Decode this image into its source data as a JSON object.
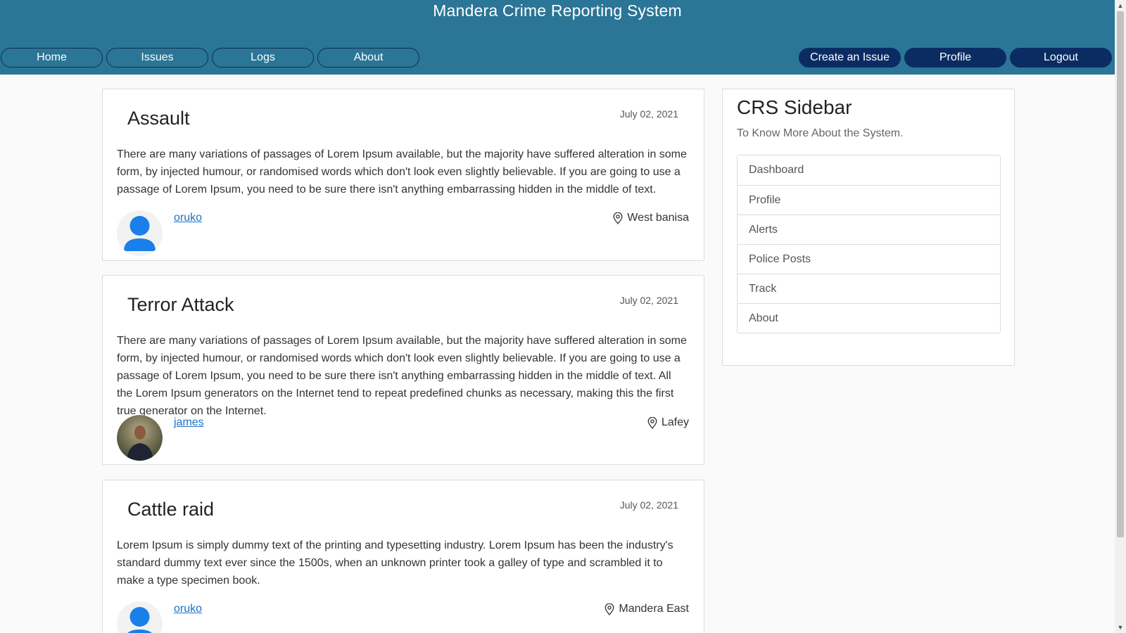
{
  "site": {
    "title": "Mandera Crime Reporting System"
  },
  "nav": {
    "left": [
      {
        "label": "Home"
      },
      {
        "label": "Issues"
      },
      {
        "label": "Logs"
      },
      {
        "label": "About"
      }
    ],
    "right": [
      {
        "label": "Create an Issue"
      },
      {
        "label": "Profile"
      },
      {
        "label": "Logout"
      }
    ]
  },
  "posts": [
    {
      "title": "Assault",
      "date": "July 02, 2021",
      "body": "There are many variations of passages of Lorem Ipsum available, but the majority have suffered alteration in some form, by injected humour, or randomised words which don't look even slightly believable. If you are going to use a passage of Lorem Ipsum, you need to be sure there isn't anything embarrassing hidden in the middle of text.",
      "author": "oruko",
      "location": "West banisa"
    },
    {
      "title": "Terror Attack",
      "date": "July 02, 2021",
      "body": "There are many variations of passages of Lorem Ipsum available, but the majority have suffered alteration in some form, by injected humour, or randomised words which don't look even slightly believable. If you are going to use a passage of Lorem Ipsum, you need to be sure there isn't anything embarrassing hidden in the middle of text. All the Lorem Ipsum generators on the Internet tend to repeat predefined chunks as necessary, making this the first true generator on the Internet.",
      "author": "james",
      "location": "Lafey"
    },
    {
      "title": "Cattle raid",
      "date": "July 02, 2021",
      "body": "Lorem Ipsum is simply dummy text of the printing and typesetting industry. Lorem Ipsum has been the industry's standard dummy text ever since the 1500s, when an unknown printer took a galley of type and scrambled it to make a type specimen book.",
      "author": "oruko",
      "location": "Mandera East"
    }
  ],
  "sidebar": {
    "title": "CRS Sidebar",
    "subtitle": "To Know More About the System.",
    "items": [
      {
        "label": "Dashboard"
      },
      {
        "label": "Profile"
      },
      {
        "label": "Alerts"
      },
      {
        "label": "Police Posts"
      },
      {
        "label": "Track"
      },
      {
        "label": "About"
      }
    ]
  },
  "colors": {
    "navbar": "#2b7596",
    "button_filled": "#0b2c63",
    "avatar_default": "#1a7fe8",
    "link": "#1a73c9"
  },
  "icons": {
    "location": "map-pin-icon",
    "default_avatar": "user-icon"
  }
}
